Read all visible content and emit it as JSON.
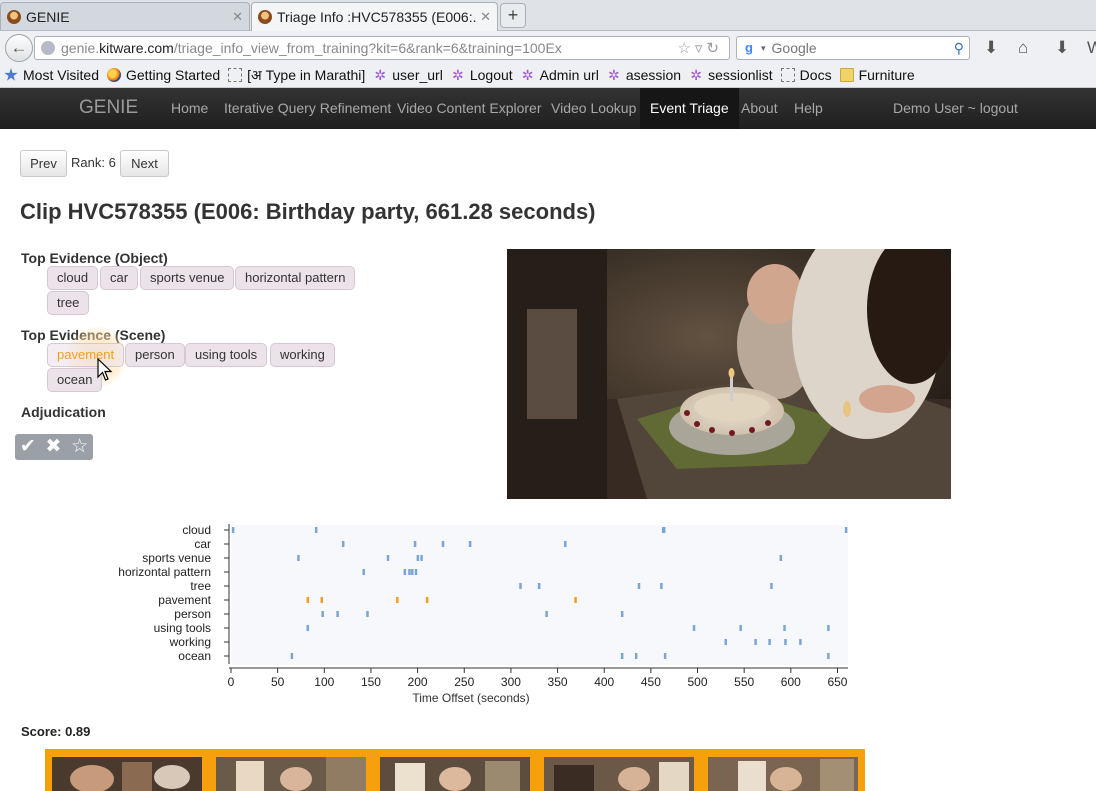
{
  "browser": {
    "tabs": [
      {
        "title": "GENIE",
        "active": false
      },
      {
        "title": "Triage Info :HVC578355 (E006:...",
        "active": true
      }
    ],
    "new_tab": "+",
    "url_domain_prefix": "genie.",
    "url_domain": "kitware.com",
    "url_path": "/triage_info_view_from_training?kit=6&rank=6&training=100Ex",
    "search_placeholder": "Google",
    "bookmarks": [
      {
        "label": "Most Visited",
        "icon": "star-icon"
      },
      {
        "label": "Getting Started",
        "icon": "firefox-icon"
      },
      {
        "label": "[अ Type in Marathi]",
        "icon": "page-icon"
      },
      {
        "label": "user_url",
        "icon": "bookmarklet-icon"
      },
      {
        "label": "Logout",
        "icon": "bookmarklet-icon"
      },
      {
        "label": "Admin url",
        "icon": "bookmarklet-icon"
      },
      {
        "label": "asession",
        "icon": "bookmarklet-icon"
      },
      {
        "label": "sessionlist",
        "icon": "bookmarklet-icon"
      },
      {
        "label": "Docs",
        "icon": "page-icon"
      },
      {
        "label": "Furniture",
        "icon": "folder-icon"
      }
    ]
  },
  "app": {
    "brand": "GENIE",
    "nav": [
      {
        "label": "Home"
      },
      {
        "label": "Iterative Query Refinement"
      },
      {
        "label": "Video Content Explorer"
      },
      {
        "label": "Video Lookup"
      },
      {
        "label": "Event Triage",
        "active": true
      },
      {
        "label": "About"
      },
      {
        "label": "Help"
      }
    ],
    "user": "Demo User ~ logout",
    "active_color": "#161616"
  },
  "pager": {
    "prev": "Prev",
    "rank": "Rank: 6",
    "next": "Next"
  },
  "clip_title": "Clip HVC578355 (E006: Birthday party, 661.28 seconds)",
  "evidence_object": {
    "heading": "Top Evidence (Object)",
    "tags": [
      "cloud",
      "car",
      "sports venue",
      "horizontal pattern",
      "tree"
    ]
  },
  "evidence_scene": {
    "heading": "Top Evidence (Scene)",
    "tags": [
      "pavement",
      "person",
      "using tools",
      "working",
      "ocean"
    ],
    "highlighted": "pavement"
  },
  "adjudication": {
    "heading": "Adjudication",
    "icons": [
      "check-icon",
      "x-icon",
      "star-icon"
    ]
  },
  "chart_data": {
    "type": "scatter",
    "title": "",
    "xlabel": "Time Offset (seconds)",
    "ylabel": "",
    "xlim": [
      0,
      661.28
    ],
    "xticks": [
      0,
      50,
      100,
      150,
      200,
      250,
      300,
      350,
      400,
      450,
      500,
      550,
      600,
      650
    ],
    "categories": [
      "cloud",
      "car",
      "sports venue",
      "horizontal pattern",
      "tree",
      "pavement",
      "person",
      "using tools",
      "working",
      "ocean"
    ],
    "highlight_category": "pavement",
    "colors": {
      "normal": "#7aa6d6",
      "highlight": "#f0a020",
      "background": "#f6f8fb"
    },
    "series": [
      {
        "label": "cloud",
        "x": [
          2,
          91,
          463,
          464,
          659
        ]
      },
      {
        "label": "car",
        "x": [
          120,
          197,
          227,
          256,
          358
        ]
      },
      {
        "label": "sports venue",
        "x": [
          72,
          168,
          200,
          204,
          589
        ]
      },
      {
        "label": "horizontal pattern",
        "x": [
          142,
          186,
          191,
          194,
          198
        ]
      },
      {
        "label": "tree",
        "x": [
          310,
          330,
          437,
          461,
          579
        ]
      },
      {
        "label": "pavement",
        "x": [
          82,
          97,
          178,
          210,
          369
        ]
      },
      {
        "label": "person",
        "x": [
          98,
          114,
          146,
          338,
          419
        ]
      },
      {
        "label": "using tools",
        "x": [
          82,
          496,
          546,
          593,
          640
        ]
      },
      {
        "label": "working",
        "x": [
          530,
          562,
          577,
          594,
          610
        ]
      },
      {
        "label": "ocean",
        "x": [
          65,
          419,
          434,
          465,
          640
        ]
      }
    ]
  },
  "score": "Score: 0.89",
  "strip_color": "#f5a00c"
}
